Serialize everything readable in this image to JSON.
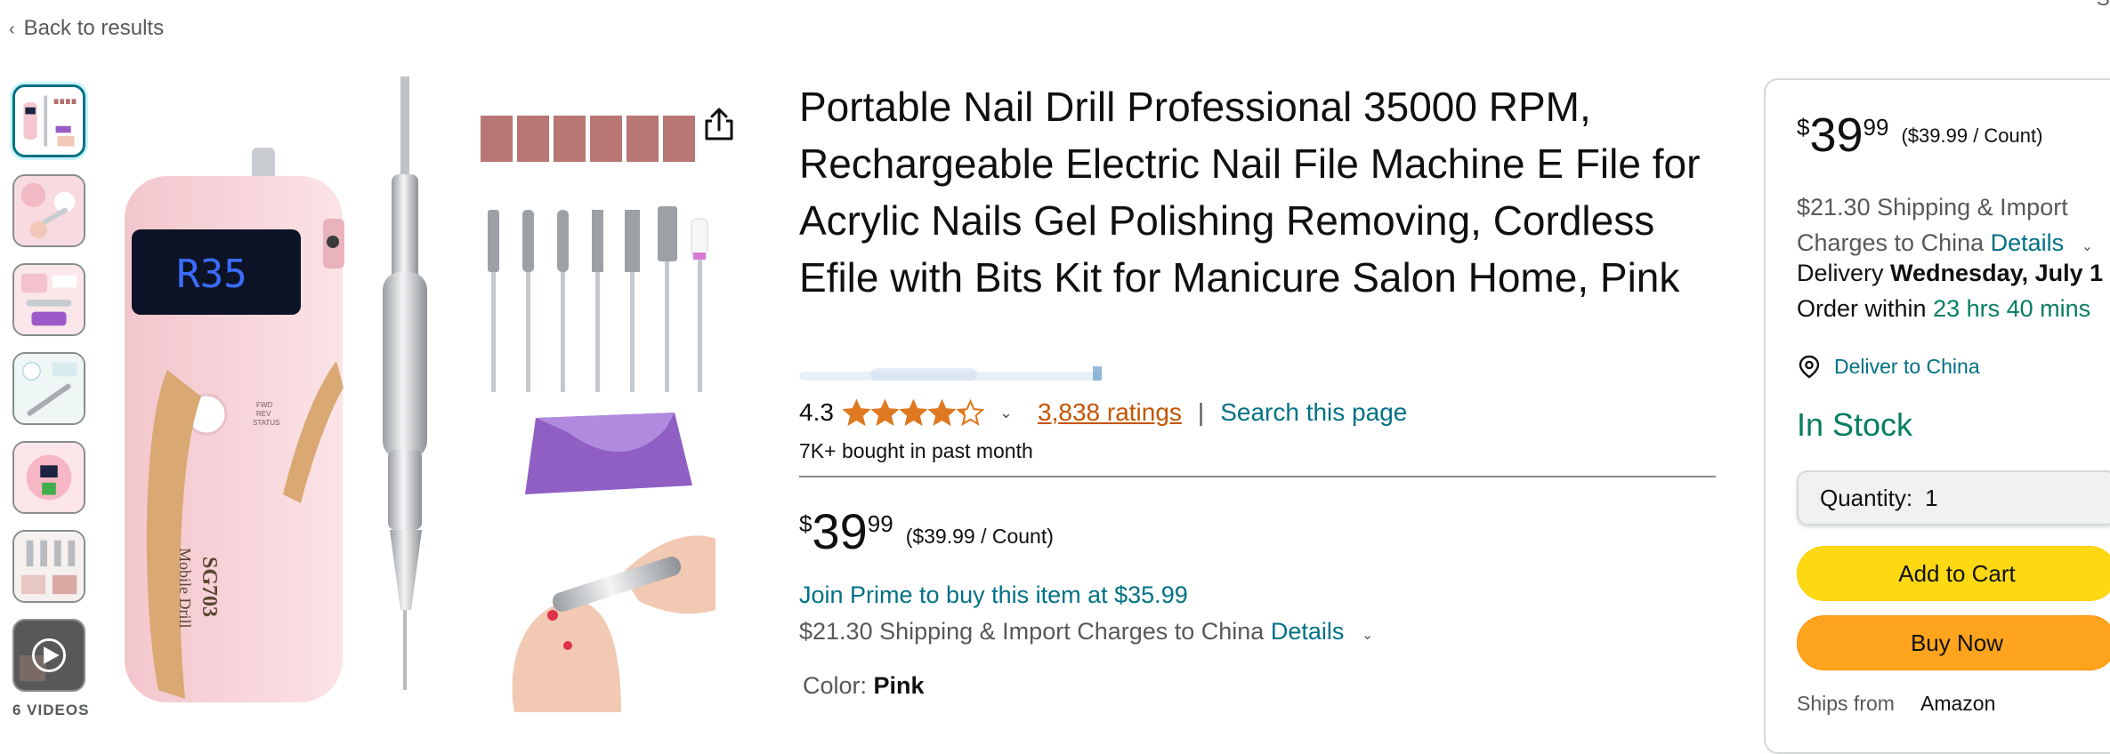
{
  "nav": {
    "back_label": "Back to results",
    "corner_text": "Sp"
  },
  "gallery": {
    "videos_label": "6 VIDEOS",
    "display_text": "R35",
    "brand": "SG703",
    "model_text": "Mobile Drill",
    "switch_labels": [
      "FWD",
      "REV",
      "STATUS"
    ]
  },
  "product": {
    "title": "Portable Nail Drill Professional 35000 RPM, Rechargeable Electric Nail File Machine E File for Acrylic Nails Gel Polishing Removing, Cordless Efile with Bits Kit for Manicure Salon Home, Pink",
    "rating": "4.3",
    "rating_value": 4.3,
    "ratings_count": "3,838 ratings",
    "separator": "|",
    "search_page": "Search this page",
    "bought": "7K+ bought in past month",
    "price": {
      "symbol": "$",
      "whole": "39",
      "fraction": "99",
      "unit": "($39.99 / Count)"
    },
    "prime": "Join Prime to buy this item at $35.99",
    "shipping_text": "$21.30 Shipping & Import Charges to China",
    "details": "Details",
    "color_label": "Color:",
    "color_value": "Pink"
  },
  "buybox": {
    "price": {
      "symbol": "$",
      "whole": "39",
      "fraction": "99",
      "unit": "($39.99 / Count)"
    },
    "shipping_text": "$21.30 Shipping & Import Charges to China",
    "details": "Details",
    "delivery_prefix": "Delivery",
    "delivery_date": "Wednesday, July 1",
    "order_prefix": "Order within",
    "order_time": "23 hrs 40 mins",
    "deliver_to": "Deliver to China",
    "stock": "In Stock",
    "quantity_label": "Quantity:",
    "quantity_value": "1",
    "add_to_cart": "Add to Cart",
    "buy_now": "Buy Now",
    "ships_from_label": "Ships from",
    "ships_from_value": "Amazon"
  },
  "colors": {
    "link": "#007185",
    "rating_link": "#c45500",
    "star": "#de7921",
    "in_stock": "#067d62",
    "add_to_cart": "#ffd814",
    "buy_now": "#ffa41c"
  }
}
